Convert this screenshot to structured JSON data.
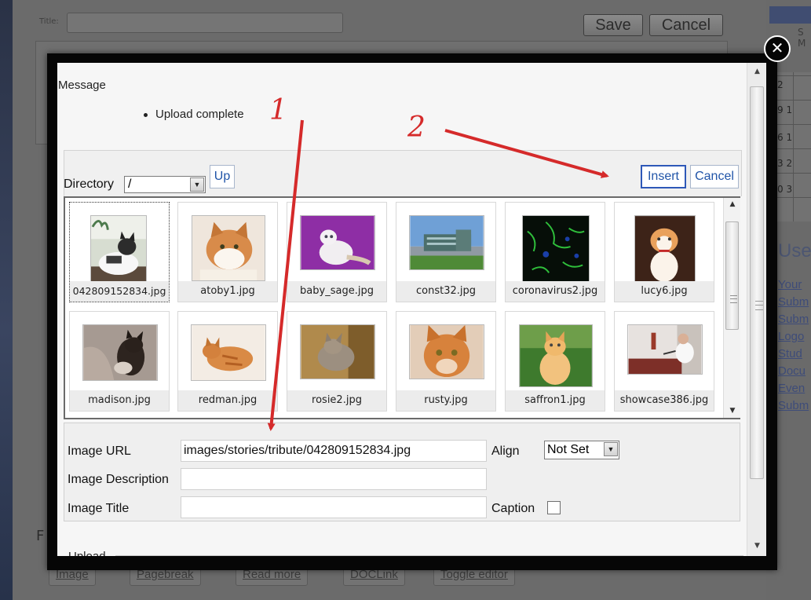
{
  "background": {
    "title_label": "Title:",
    "save_label": "Save",
    "cancel_label": "Cancel",
    "calendar_days": "S M",
    "calendar_rows": [
      "2",
      "9  1",
      "6  1",
      "3  2",
      "0  3"
    ],
    "sidebar_title": "User",
    "sidebar_links": [
      "Your",
      "Subm",
      "Subm",
      "Logo",
      "Stud",
      "Docu",
      "Even",
      "Subm"
    ],
    "editor_buttons": [
      "Image",
      "Pagebreak",
      "Read more",
      "DOCLink",
      "Toggle editor"
    ],
    "letter_f": "F"
  },
  "modal": {
    "close_symbol": "✕",
    "message_title": "Message",
    "message_items": [
      "Upload complete"
    ],
    "annotations": [
      "1",
      "2"
    ],
    "directory_label": "Directory",
    "directory_value": "/",
    "up_label": "Up",
    "insert_label": "Insert",
    "cancel_label": "Cancel",
    "images": [
      "042809152834.jpg",
      "atoby1.jpg",
      "baby_sage.jpg",
      "const32.jpg",
      "coronavirus2.jpg",
      "lucy6.jpg",
      "madison.jpg",
      "redman.jpg",
      "rosie2.jpg",
      "rusty.jpg",
      "saffron1.jpg",
      "showcase386.jpg"
    ],
    "selected_image": "042809152834.jpg",
    "form": {
      "image_url_label": "Image URL",
      "image_url_value": "images/stories/tribute/042809152834.jpg",
      "image_description_label": "Image Description",
      "image_description_value": "",
      "image_title_label": "Image Title",
      "image_title_value": "",
      "align_label": "Align",
      "align_value": "Not Set",
      "caption_label": "Caption",
      "caption_checked": false
    },
    "upload_legend": "Upload"
  },
  "colors": {
    "annotation_red": "#d52a2a",
    "link_blue": "#2054a8",
    "overlay_gray": "#6b6b6b"
  }
}
